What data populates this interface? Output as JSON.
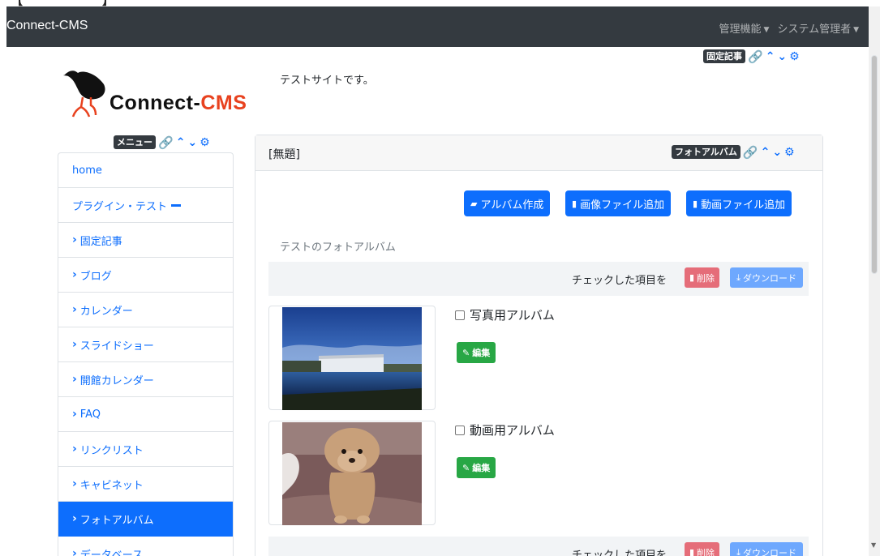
{
  "navbar": {
    "brand": "Connect-CMS",
    "admin_menu": "管理機能",
    "user_menu": "システム管理者"
  },
  "header_frame": {
    "badge": "固定記事"
  },
  "logo": {
    "text_main": "Connect-",
    "text_accent": "CMS"
  },
  "site_description": "テストサイトです。",
  "menu_frame": {
    "badge": "メニュー",
    "items": [
      {
        "label": "home",
        "chevron": false
      },
      {
        "label": "プラグイン・テスト",
        "chevron": false,
        "minus": true
      },
      {
        "label": "固定記事",
        "chevron": true
      },
      {
        "label": "ブログ",
        "chevron": true
      },
      {
        "label": "カレンダー",
        "chevron": true
      },
      {
        "label": "スライドショー",
        "chevron": true
      },
      {
        "label": "開館カレンダー",
        "chevron": true
      },
      {
        "label": "FAQ",
        "chevron": true
      },
      {
        "label": "リンクリスト",
        "chevron": true
      },
      {
        "label": "キャビネット",
        "chevron": true
      },
      {
        "label": "フォトアルバム",
        "chevron": true,
        "active": true
      },
      {
        "label": "データベース",
        "chevron": true
      }
    ]
  },
  "photo_frame": {
    "title": "[無題]",
    "badge": "フォトアルバム",
    "buttons": {
      "create_album": "アルバム作成",
      "add_image": "画像ファイル追加",
      "add_video": "動画ファイル追加"
    },
    "album_description": "テストのフォトアルバム",
    "bulk": {
      "label": "チェックした項目を",
      "delete": "削除",
      "download": "ダウンロード"
    },
    "albums": [
      {
        "name": "写真用アルバム",
        "edit": "編集"
      },
      {
        "name": "動画用アルバム",
        "edit": "編集"
      }
    ]
  },
  "colors": {
    "primary": "#0d6efd",
    "navbar": "#343a40",
    "success": "#28a745",
    "danger_light": "#e56d79",
    "primary_light": "#6ea8fe",
    "logo_accent": "#e8421f"
  }
}
